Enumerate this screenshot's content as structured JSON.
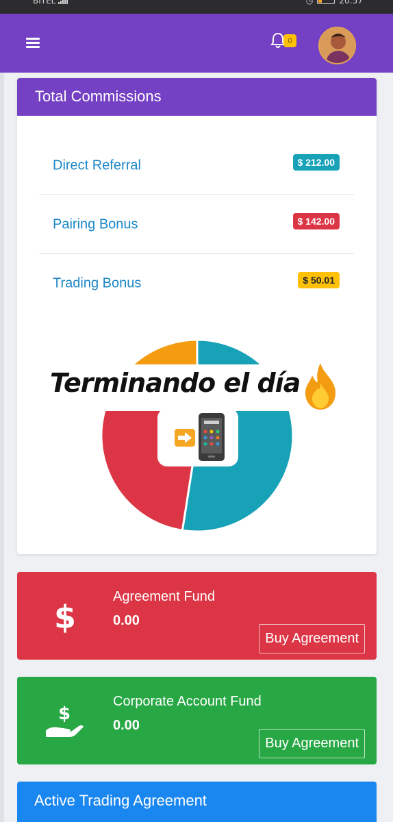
{
  "status_bar": {
    "carrier": "BITEL",
    "time": "20:57",
    "battery": "15"
  },
  "header": {
    "notification_count": "0"
  },
  "commissions": {
    "title": "Total Commissions",
    "rows": [
      {
        "label": "Direct Referral",
        "amount": "$ 212.00",
        "color": "#17a2b8",
        "text_color": "#ffffff"
      },
      {
        "label": "Pairing Bonus",
        "amount": "$ 142.00",
        "color": "#dc3545",
        "text_color": "#ffffff"
      },
      {
        "label": "Trading Bonus",
        "amount": "$ 50.01",
        "color": "#ffc107",
        "text_color": "#212529"
      }
    ],
    "chart_data": {
      "type": "pie",
      "labels": [
        "Direct Referral",
        "Pairing Bonus",
        "Trading Bonus"
      ],
      "values": [
        212.0,
        142.0,
        50.01
      ],
      "colors": [
        "#17a2b8",
        "#dc3545",
        "#f39c12"
      ]
    },
    "overlay_text": "Terminando el día"
  },
  "funds": [
    {
      "title": "Agreement Fund",
      "value": "0.00",
      "button": "Buy Agreement",
      "icon": "dollar-icon",
      "color": "#dc3545"
    },
    {
      "title": "Corporate Account Fund",
      "value": "0.00",
      "button": "Buy Agreement",
      "icon": "hand-dollar-icon",
      "color": "#28a745"
    }
  ],
  "active_trading": {
    "title": "Active Trading Agreement"
  }
}
